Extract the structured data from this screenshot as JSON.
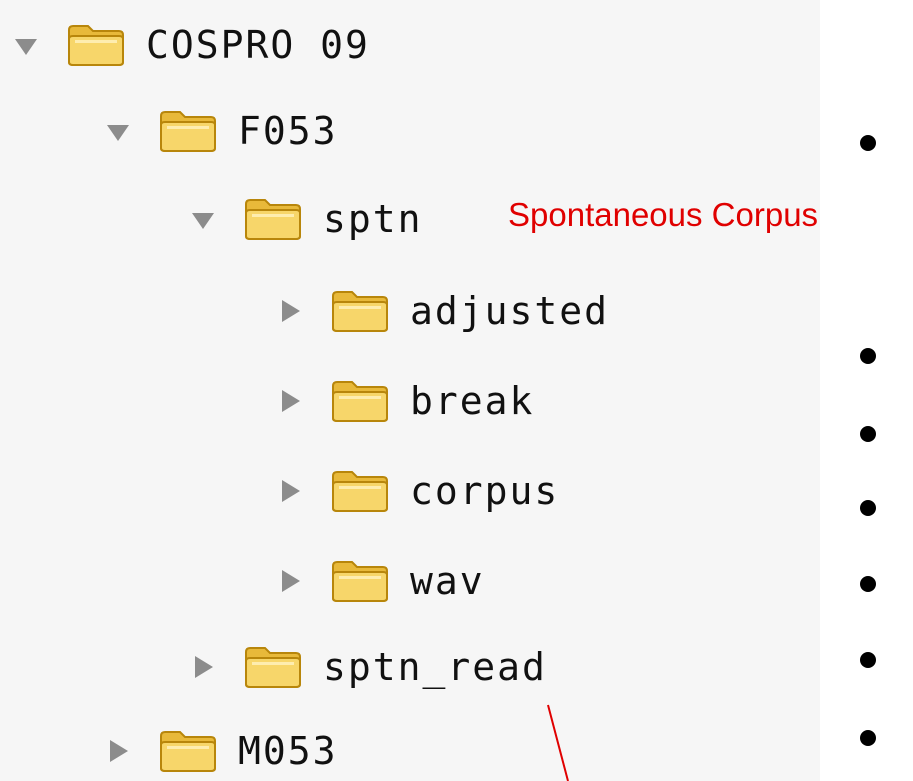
{
  "tree": {
    "rows": [
      {
        "label": "COSPRO 09",
        "state": "expanded"
      },
      {
        "label": "F053",
        "state": "expanded"
      },
      {
        "label": "sptn",
        "state": "expanded"
      },
      {
        "label": "adjusted",
        "state": "collapsed"
      },
      {
        "label": "break",
        "state": "collapsed"
      },
      {
        "label": "corpus",
        "state": "collapsed"
      },
      {
        "label": "wav",
        "state": "collapsed"
      },
      {
        "label": "sptn_read",
        "state": "collapsed"
      },
      {
        "label": "M053",
        "state": "collapsed"
      }
    ]
  },
  "annotation": {
    "text": "Spontaneous Corpus",
    "color": "#e00000"
  },
  "colors": {
    "folder_fill": "#f5cf5a",
    "folder_outline": "#b8860b",
    "toggle": "#8c8c8c"
  },
  "icons": {
    "expanded": "triangle-down-icon",
    "collapsed": "triangle-right-icon",
    "folder": "folder-icon"
  }
}
